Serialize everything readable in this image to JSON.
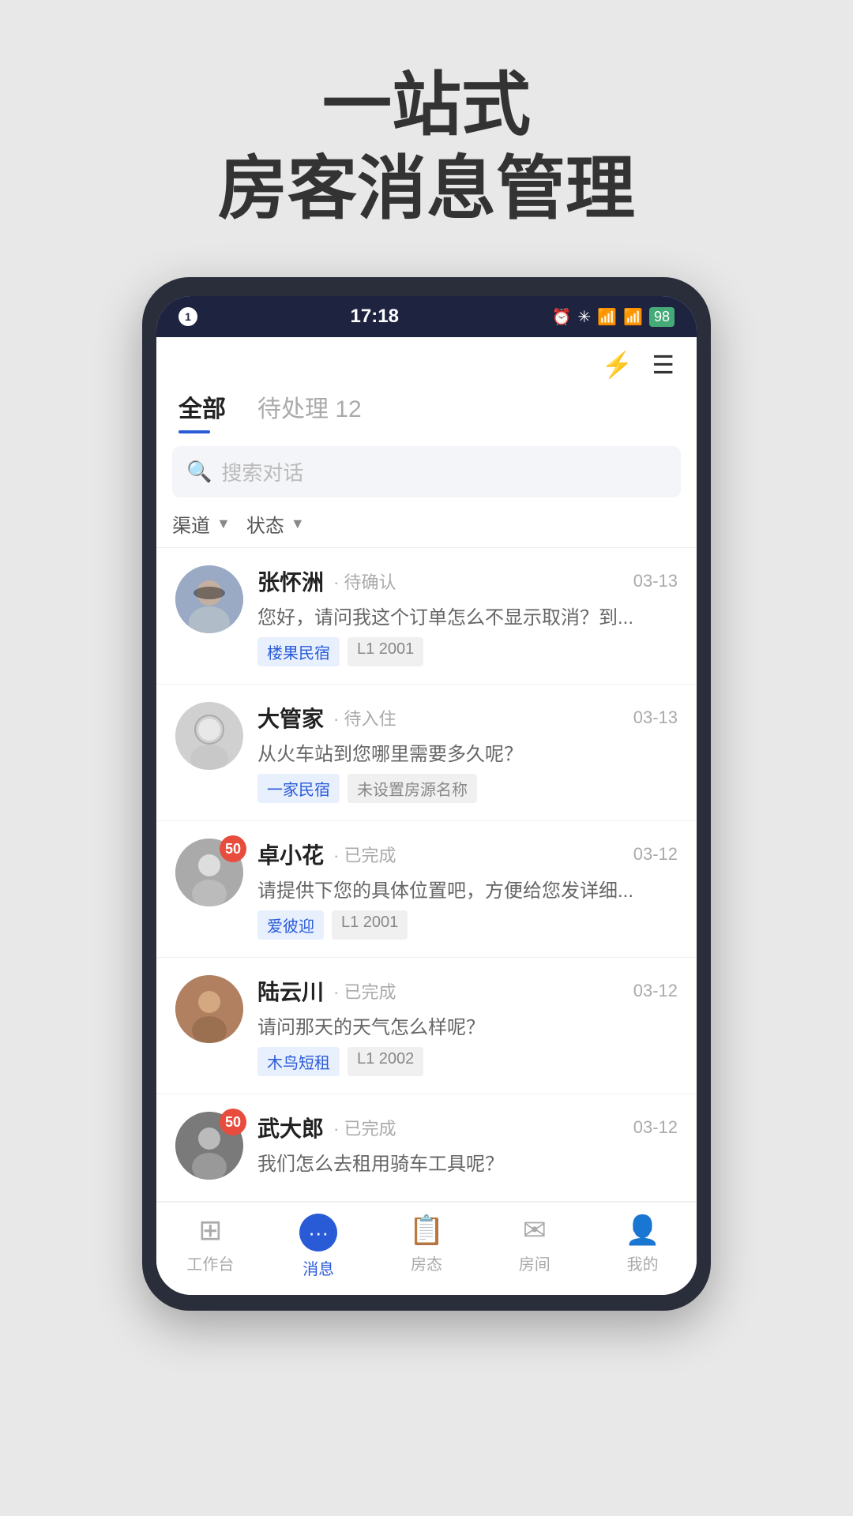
{
  "hero": {
    "line1": "一站式",
    "line2": "房客消息管理"
  },
  "statusBar": {
    "dot": "1",
    "time": "17:18",
    "battery": "98"
  },
  "header": {
    "tabs": [
      {
        "id": "all",
        "label": "全部",
        "active": true
      },
      {
        "id": "pending",
        "label": "待处理 12",
        "active": false
      }
    ],
    "lightning_icon": "⚡",
    "menu_icon": "☰"
  },
  "search": {
    "placeholder": "搜索对话"
  },
  "filters": [
    {
      "id": "channel",
      "label": "渠道"
    },
    {
      "id": "status",
      "label": "状态"
    }
  ],
  "messages": [
    {
      "id": 1,
      "name": "张怀洲",
      "status": "待确认",
      "time": "03-13",
      "preview": "您好，请问我这个订单怎么不显示取消？到...",
      "tags": [
        {
          "text": "楼果民宿",
          "type": "blue"
        },
        {
          "text": "L1 2001",
          "type": "gray"
        }
      ],
      "avatar_class": "av-1",
      "badge": null
    },
    {
      "id": 2,
      "name": "大管家",
      "status": "待入住",
      "time": "03-13",
      "preview": "从火车站到您哪里需要多久呢？",
      "tags": [
        {
          "text": "一家民宿",
          "type": "blue"
        },
        {
          "text": "未设置房源名称",
          "type": "gray"
        }
      ],
      "avatar_class": "av-2",
      "badge": null
    },
    {
      "id": 3,
      "name": "卓小花",
      "status": "已完成",
      "time": "03-12",
      "preview": "请提供下您的具体位置吧，方便给您发详细...",
      "tags": [
        {
          "text": "爱彼迎",
          "type": "blue"
        },
        {
          "text": "L1 2001",
          "type": "gray"
        }
      ],
      "avatar_class": "av-3",
      "badge": "50"
    },
    {
      "id": 4,
      "name": "陆云川",
      "status": "已完成",
      "time": "03-12",
      "preview": "请问那天的天气怎么样呢？",
      "tags": [
        {
          "text": "木鸟短租",
          "type": "blue"
        },
        {
          "text": "L1 2002",
          "type": "gray"
        }
      ],
      "avatar_class": "av-4",
      "badge": null
    },
    {
      "id": 5,
      "name": "武大郎",
      "status": "已完成",
      "time": "03-12",
      "preview": "我们怎么去租用骑车工具呢？",
      "tags": [],
      "avatar_class": "av-5",
      "badge": "50"
    }
  ],
  "bottomNav": [
    {
      "id": "workbench",
      "label": "工作台",
      "icon": "⊞",
      "active": false
    },
    {
      "id": "messages",
      "label": "消息",
      "icon": "💬",
      "active": true
    },
    {
      "id": "schedule",
      "label": "房态",
      "icon": "📅",
      "active": false
    },
    {
      "id": "mail",
      "label": "房间",
      "icon": "✉",
      "active": false
    },
    {
      "id": "profile",
      "label": "我的",
      "icon": "👤",
      "active": false
    }
  ]
}
